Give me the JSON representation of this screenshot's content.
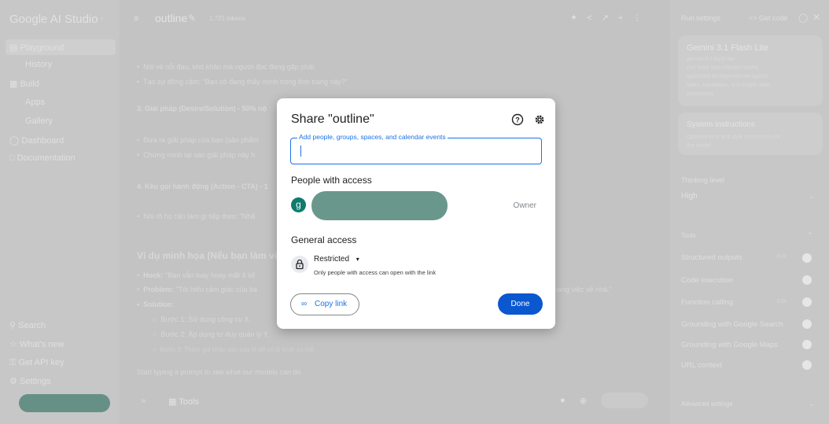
{
  "app": {
    "brand": "Google AI Studio",
    "doc_title": "outline",
    "token_count": "1,721 tokens"
  },
  "sidebar": {
    "items": [
      {
        "label": "Playground"
      },
      {
        "label": "History"
      },
      {
        "label": "Build"
      },
      {
        "label": "Apps"
      },
      {
        "label": "Gallery"
      },
      {
        "label": "Dashboard"
      },
      {
        "label": "Documentation"
      }
    ],
    "bottom": [
      {
        "label": "Search"
      },
      {
        "label": "What's new"
      },
      {
        "label": "Get API key"
      },
      {
        "label": "Settings"
      }
    ]
  },
  "main": {
    "lines": [
      "Nói về nỗi đau, khó khăn mà người đọc đang gặp phải.",
      "Tạo sự đồng cảm: \"Bạn có đang thấy mình trong tình trạng này?\"",
      "3. Giải pháp (Desire/Solution) - 50% nộ",
      "Đưa ra giải pháp của bạn (sản phẩm",
      "Chứng minh tại sao giải pháp này h",
      "4. Kêu gọi hành động (Action - CTA) - 1",
      "Nói rõ họ cần làm gì tiếp theo: \"Nhấ",
      "Ví dụ minh họa (Nếu bạn làm về l",
      "Hook:",
      "\"Bạn vẫn loay hoay mất 4 tiế",
      "Problem:",
      "\"Tôi hiểu cảm giác của ba",
      "nang việc về nhà.\"",
      "Solution:",
      "Bước 1: Sử dụng công cụ X.",
      "Bước 2: Áp dụng tư duy quản lý Y.",
      "Bước 3: Thêm gia khâu sau của tế để có lộ trình cụ thể"
    ],
    "prompt_placeholder": "Start typing a prompt to see what our models can do",
    "tools_label": "Tools"
  },
  "right": {
    "header": "Run settings",
    "get_code": "Get code",
    "model_name": "Gemini 3.1 Flash Lite",
    "model_desc_lines": [
      "gemini-3.1-flash-lite",
      "Our most cost-efficient model,",
      "optimized for high-volume agentic",
      "tasks, translation, and simple data",
      "processing."
    ],
    "sys_title": "System instructions",
    "sys_desc_lines": [
      "Optional tone and style instructions for",
      "the model"
    ],
    "thinking_label": "Thinking level",
    "thinking_value": "High",
    "tools_header": "Tools",
    "tools": [
      {
        "label": "Structured outputs",
        "extra": "Edit"
      },
      {
        "label": "Code execution",
        "extra": ""
      },
      {
        "label": "Function calling",
        "extra": "Edit"
      },
      {
        "label": "Grounding with Google Search",
        "extra": ""
      },
      {
        "label": "Grounding with Google Maps",
        "extra": ""
      },
      {
        "label": "URL context",
        "extra": ""
      }
    ],
    "advanced": "Advanced settings"
  },
  "dialog": {
    "title": "Share \"outline\"",
    "input_label": "Add people, groups, spaces, and calendar events",
    "people_heading": "People with access",
    "avatar_letter": "g",
    "owner_label": "Owner",
    "general_heading": "General access",
    "access_value": "Restricted",
    "access_desc": "Only people with access can open with the link",
    "copy_link": "Copy link",
    "done": "Done"
  },
  "colors": {
    "accent": "#1a73e8",
    "done_bg": "#0b57d0",
    "avatar": "#0f7b6c",
    "redact": "#6a978c"
  }
}
